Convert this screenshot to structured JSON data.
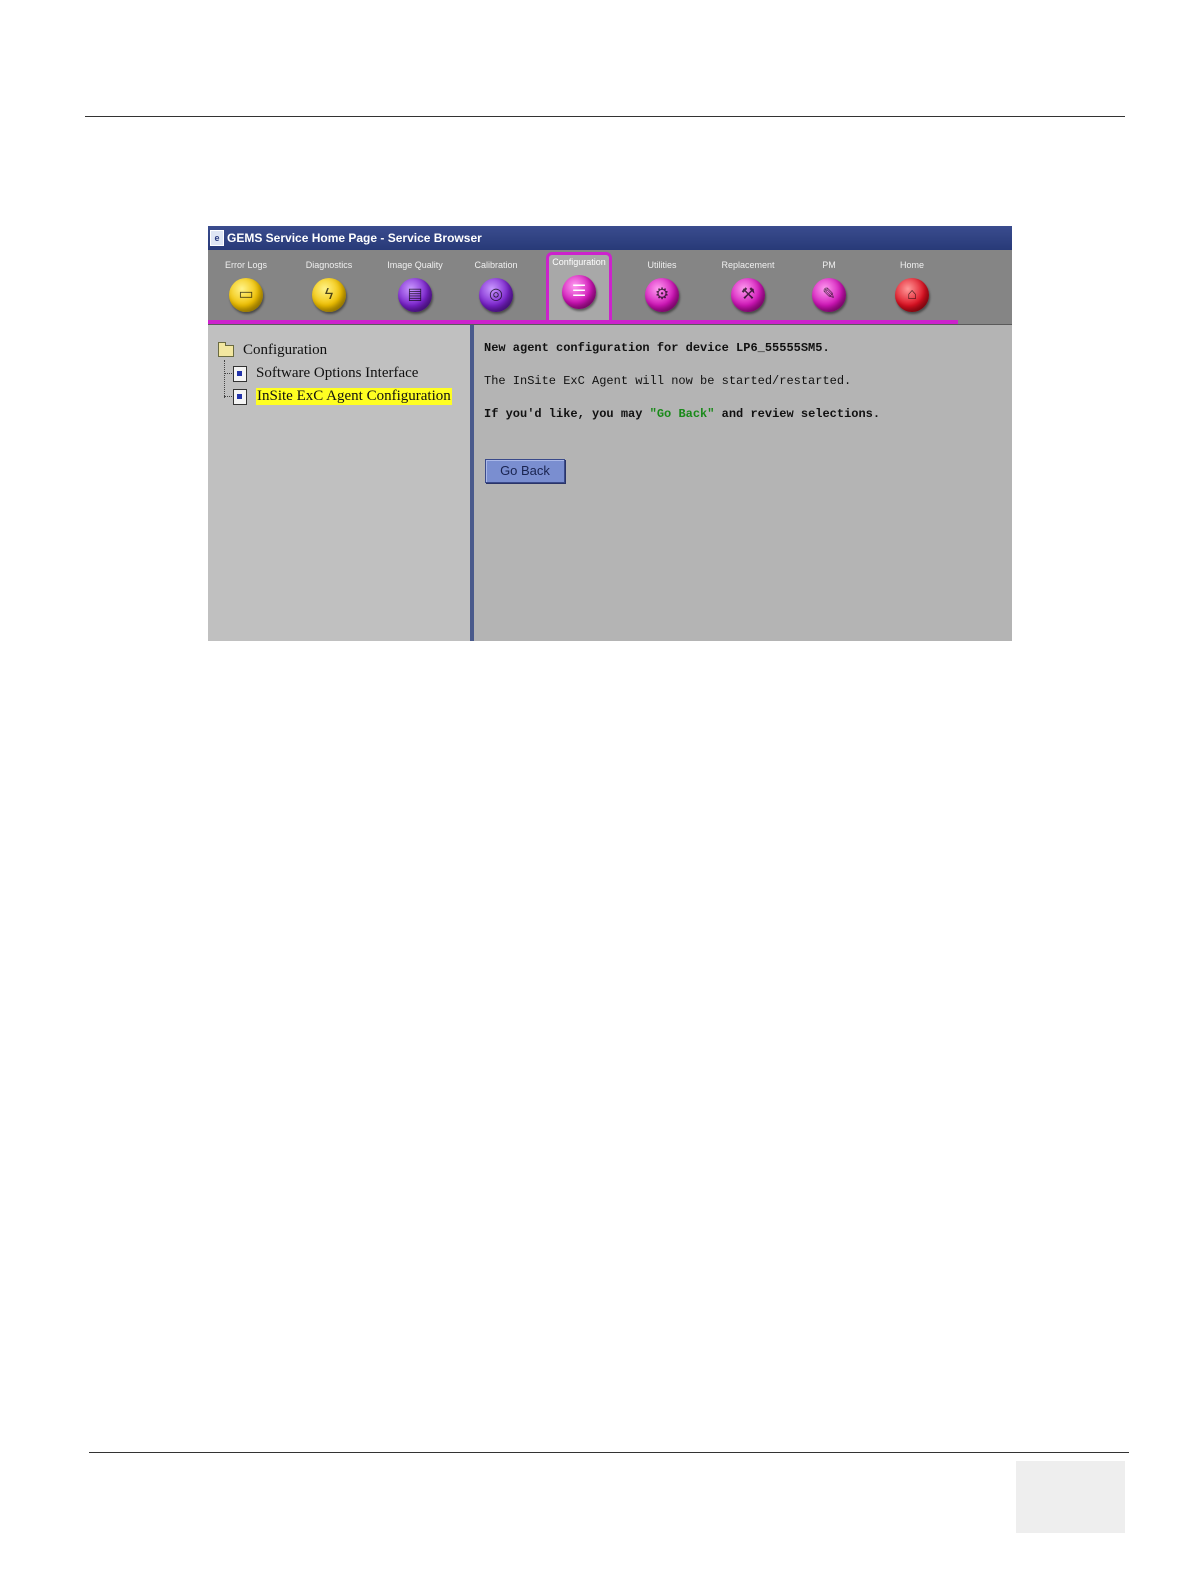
{
  "window": {
    "title": "GEMS Service Home Page - Service Browser"
  },
  "toolbar": {
    "tabs": [
      {
        "label": "Error Logs",
        "icon": "error-logs-icon",
        "color": "yellow",
        "glyph": "▭"
      },
      {
        "label": "Diagnostics",
        "icon": "stethoscope-icon",
        "color": "yellow",
        "glyph": "ϟ"
      },
      {
        "label": "Image Quality",
        "icon": "image-quality-icon",
        "color": "purple",
        "glyph": "▤"
      },
      {
        "label": "Calibration",
        "icon": "calibration-icon",
        "color": "purple",
        "glyph": "◎"
      },
      {
        "label": "Configuration",
        "icon": "configuration-icon",
        "color": "magenta",
        "glyph": "☰",
        "active": true
      },
      {
        "label": "Utilities",
        "icon": "utilities-icon",
        "color": "magenta",
        "glyph": "⚙"
      },
      {
        "label": "Replacement",
        "icon": "replacement-icon",
        "color": "magenta",
        "glyph": "⚒"
      },
      {
        "label": "PM",
        "icon": "pm-icon",
        "color": "magenta",
        "glyph": "✎"
      },
      {
        "label": "Home",
        "icon": "home-icon",
        "color": "red",
        "glyph": "⌂"
      }
    ]
  },
  "tree": {
    "root": "Configuration",
    "items": [
      {
        "label": "Software Options Interface",
        "selected": false
      },
      {
        "label": "InSite ExC Agent Configuration",
        "selected": true
      }
    ]
  },
  "content": {
    "line1": "New agent configuration for device LP6_55555SM5.",
    "line2": "The InSite ExC Agent will now be started/restarted.",
    "line3_prefix": "If you'd like, you may ",
    "line3_link": "\"Go Back\"",
    "line3_suffix": " and review selections.",
    "go_back_label": "Go Back"
  },
  "colors": {
    "accent_tab": "#cc22cc",
    "titlebar": "#2b3c80",
    "highlight": "#ffff22",
    "link_green": "#1a8a1a"
  }
}
